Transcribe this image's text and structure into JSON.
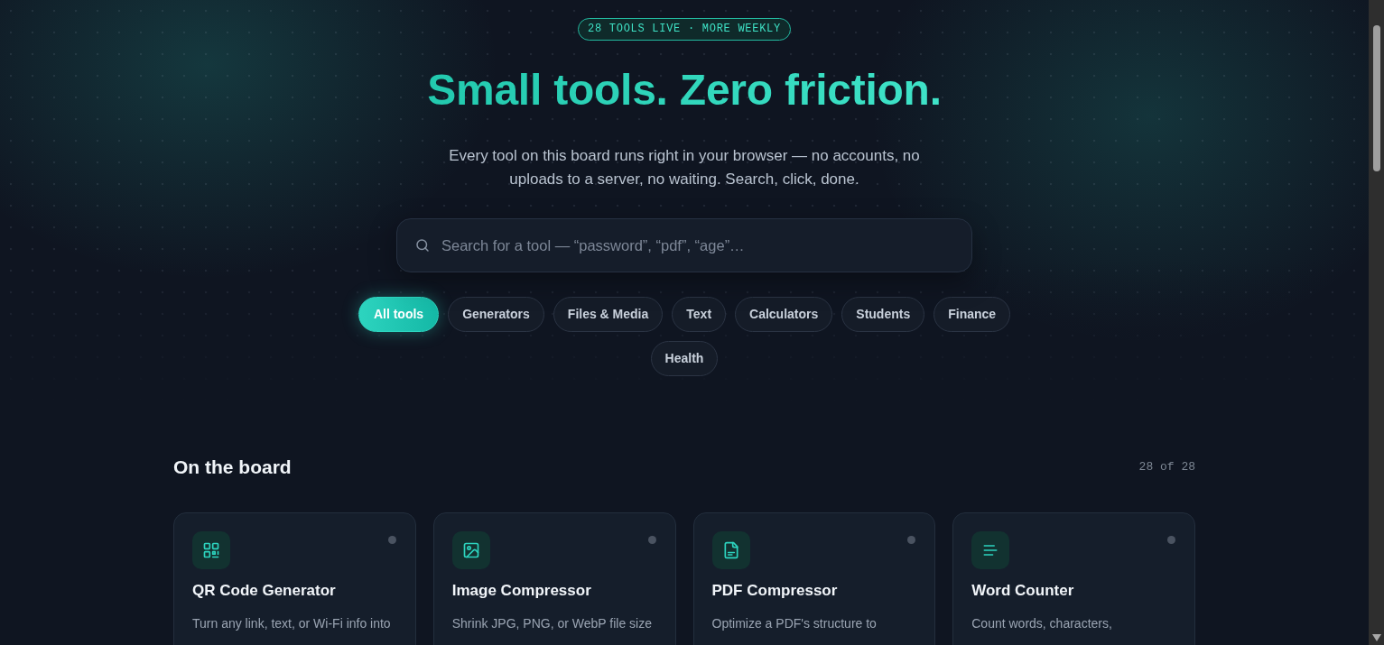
{
  "badge": "28 TOOLS LIVE · MORE WEEKLY",
  "hero": {
    "title": "Small tools. Zero friction.",
    "subtitle": "Every tool on this board runs right in your browser — no accounts, no uploads to a server, no waiting. Search, click, done."
  },
  "search": {
    "placeholder": "Search for a tool — “password”, “pdf”, “age”…"
  },
  "categories": [
    {
      "label": "All tools",
      "selected": true
    },
    {
      "label": "Generators",
      "selected": false
    },
    {
      "label": "Files & Media",
      "selected": false
    },
    {
      "label": "Text",
      "selected": false
    },
    {
      "label": "Calculators",
      "selected": false
    },
    {
      "label": "Students",
      "selected": false
    },
    {
      "label": "Finance",
      "selected": false
    },
    {
      "label": "Health",
      "selected": false
    }
  ],
  "section": {
    "title": "On the board",
    "count": "28 of 28"
  },
  "tools": [
    {
      "name": "QR Code Generator",
      "description": "Turn any link, text, or Wi-Fi info into"
    },
    {
      "name": "Image Compressor",
      "description": "Shrink JPG, PNG, or WebP file size"
    },
    {
      "name": "PDF Compressor",
      "description": "Optimize a PDF's structure to"
    },
    {
      "name": "Word Counter",
      "description": "Count words, characters,"
    }
  ]
}
